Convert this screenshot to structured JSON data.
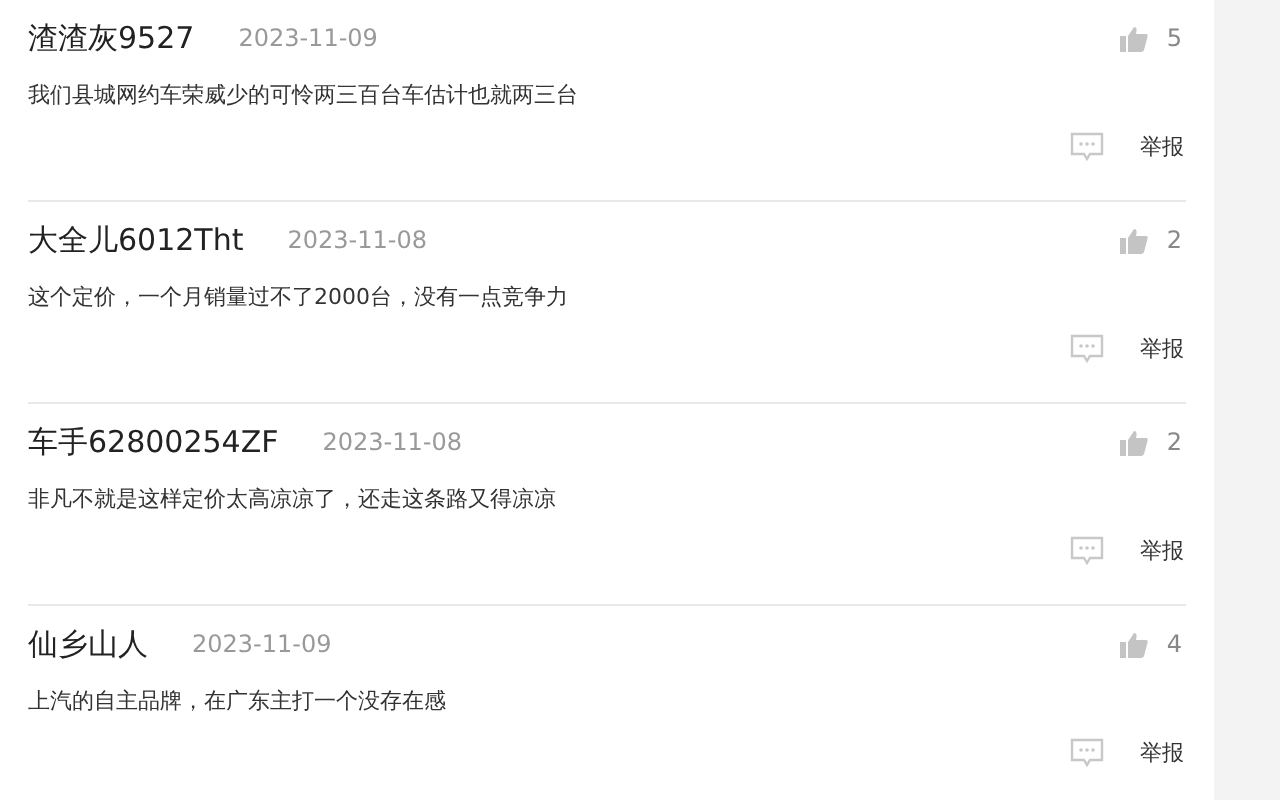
{
  "comments": [
    {
      "user": "渣渣灰9527",
      "date": "2023-11-09",
      "likes": "5",
      "text": "我们县城网约车荣威少的可怜两三百台车估计也就两三台",
      "report": "举报"
    },
    {
      "user": "大全儿6012Tht",
      "date": "2023-11-08",
      "likes": "2",
      "text": "这个定价，一个月销量过不了2000台，没有一点竞争力",
      "report": "举报"
    },
    {
      "user": "车手62800254ZF",
      "date": "2023-11-08",
      "likes": "2",
      "text": "非凡不就是这样定价太高凉凉了，还走这条路又得凉凉",
      "report": "举报"
    },
    {
      "user": "仙乡山人",
      "date": "2023-11-09",
      "likes": "4",
      "text": "上汽的自主品牌，在广东主打一个没存在感",
      "report": "举报"
    }
  ]
}
